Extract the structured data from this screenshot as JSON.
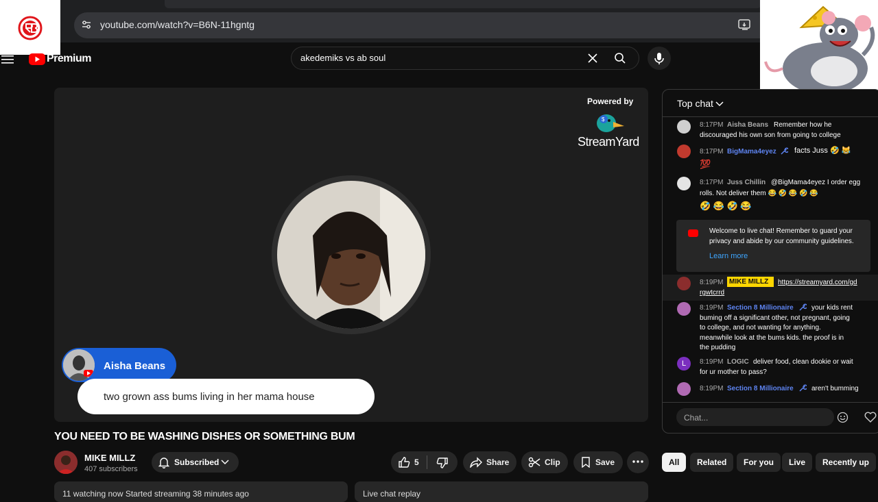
{
  "browser": {
    "url": "youtube.com/watch?v=B6N-11hgntg"
  },
  "header": {
    "brand": "Premium",
    "search_query": "akedemiks vs ab soul"
  },
  "player": {
    "powered_by": "Powered by",
    "streamyard": "StreamYard",
    "overlay_comment": {
      "author": "Aisha Beans",
      "text": "two grown ass bums living in her mama house"
    }
  },
  "video": {
    "title": "YOU NEED TO BE WASHING DISHES OR SOMETHING BUM",
    "channel": "MIKE MILLZ",
    "subscribers": "407 subscribers",
    "subscribe_label": "Subscribed",
    "likes": "5",
    "share_label": "Share",
    "clip_label": "Clip",
    "save_label": "Save",
    "desc_1": "11 watching now  Started streaming 38 minutes ago",
    "desc_2": "Live chat replay"
  },
  "chat": {
    "mode": "Top chat",
    "input_placeholder": "Chat...",
    "messages": [
      {
        "time": "8:17PM",
        "author": "Aisha Beans",
        "text": "Remember how he",
        "text2": "discouraged his own son from going to college"
      },
      {
        "time": "8:17PM",
        "author": "BigMama4eyez",
        "text": "facts Juss 🤣 😹",
        "text2": "💯"
      },
      {
        "time": "8:17PM",
        "author": "Juss Chillin",
        "text": "@BigMama4eyez I order egg",
        "text2": "rolls. Not deliver them 😂 🤣 😂 🤣 😂",
        "text3": "🤣 😂 🤣 😂"
      },
      {
        "time": "8:19PM",
        "author": "MIKE MILLZ",
        "text": "https://streamyard.com/gd",
        "text2": "rgwtcrrd"
      },
      {
        "time": "8:19PM",
        "author": "Section 8 Millionaire",
        "text": "your kids rent",
        "text2": "buming off a significant other, not pregnant, going",
        "text3": "to college, and not wanting for anything.",
        "text4": "meanwhile look at the bums kids. the proof is in",
        "text5": "the pudding"
      },
      {
        "time": "8:19PM",
        "author": "LOGIC",
        "text": "deliver food, clean dookie or wait",
        "text2": "for ur mother to pass?"
      },
      {
        "time": "8:19PM",
        "author": "Section 8 Millionaire",
        "text": "aren't bumming"
      }
    ],
    "welcome": {
      "text": "Welcome to live chat! Remember to guard your privacy and abide by our community guidelines.",
      "link": "Learn more"
    }
  },
  "chips": [
    "All",
    "Related",
    "For you",
    "Live",
    "Recently up"
  ],
  "colors": {
    "background": "#0f0f0f",
    "accent_red": "#ff0000",
    "pill_blue": "#1a5fd6",
    "owner_badge": "#ffd600",
    "link_blue": "#3ea6ff",
    "chat_author_blue": "#5e84f1"
  }
}
